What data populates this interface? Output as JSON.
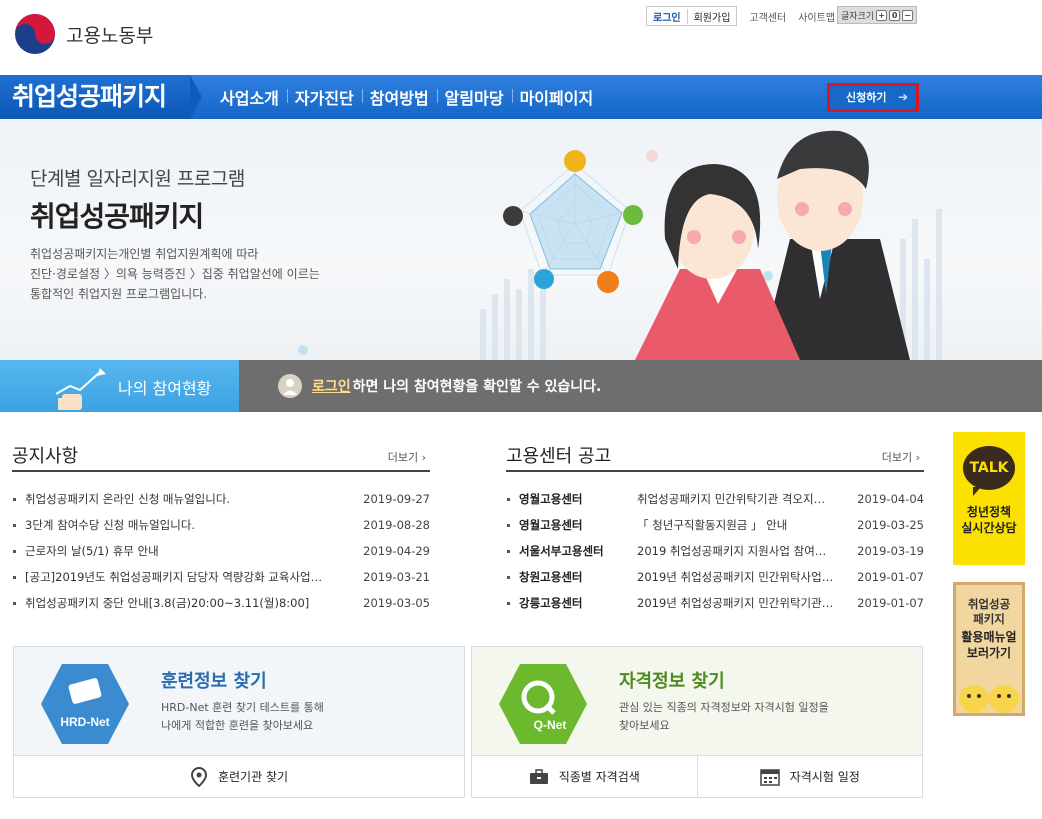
{
  "header": {
    "logo_text": "고용노동부",
    "util": {
      "login": "로그인",
      "signup": "회원가입",
      "customer_center": "고객센터",
      "sitemap": "사이트맵",
      "font_size": "글자크기",
      "font_plus": "+",
      "font_reset": "0",
      "font_minus": "−"
    }
  },
  "nav": {
    "brand": "취업성공패키지",
    "items": [
      "사업소개",
      "자가진단",
      "참여방법",
      "알림마당",
      "마이페이지"
    ],
    "apply": "신청하기"
  },
  "hero": {
    "subtitle": "단계별 일자리지원 프로그램",
    "title": "취업성공패키지",
    "desc1": "취업성공패키지는개인별 취업지원계획에 따라",
    "desc2": "진단·경로설정 〉의욕 능력증진 〉집중 취업알선에 이르는",
    "desc3": "통합적인 취업지원 프로그램입니다."
  },
  "participation": {
    "label": "나의 참여현황",
    "login_link": "로그인",
    "message": " 하면 나의 참여현황을 확인할 수 있습니다."
  },
  "notices": {
    "title": "공지사항",
    "more": "더보기",
    "items": [
      {
        "text": "취업성공패키지 온라인 신청 매뉴얼입니다.",
        "date": "2019-09-27"
      },
      {
        "text": "3단계 참여수당 신청 매뉴얼입니다.",
        "date": "2019-08-28"
      },
      {
        "text": "근로자의 날(5/1) 휴무 안내",
        "date": "2019-04-29"
      },
      {
        "text": "[공고]2019년도 취업성공패키지 담당자 역량강화 교육사업…",
        "date": "2019-03-21"
      },
      {
        "text": "취업성공패키지 중단 안내[3.8(금)20:00~3.11(월)8:00]",
        "date": "2019-03-05"
      }
    ]
  },
  "center_notices": {
    "title": "고용센터 공고",
    "more": "더보기",
    "items": [
      {
        "center": "영월고용센터",
        "text": "취업성공패키지 민간위탁기관 격오지…",
        "date": "2019-04-04"
      },
      {
        "center": "영월고용센터",
        "text": "「 청년구직활동지원금 」 안내",
        "date": "2019-03-25"
      },
      {
        "center": "서울서부고용센터",
        "text": "2019 취업성공패키지 지원사업 참여…",
        "date": "2019-03-19"
      },
      {
        "center": "창원고용센터",
        "text": "2019년 취업성공패키지 민간위탁사업…",
        "date": "2019-01-07"
      },
      {
        "center": "강릉고용센터",
        "text": "2019년 취업성공패키지 민간위탁기관…",
        "date": "2019-01-07"
      }
    ]
  },
  "side": {
    "kakao_badge": "TALK",
    "kakao_line1": "청년정책",
    "kakao_line2": "실시간상담",
    "manual_line1": "취업성공",
    "manual_line2": "패키지",
    "manual_line3": "활용매뉴얼",
    "manual_line4": "보러가기"
  },
  "cards": {
    "hrd": {
      "logo": "HRD-Net",
      "title": "훈련정보 찾기",
      "desc1": "HRD-Net 훈련 찾기 테스트를 통해",
      "desc2": "나에게 적합한 훈련을 찾아보세요",
      "link1": "훈련기관 찾기"
    },
    "qnet": {
      "logo": "Q-Net",
      "title": "자격정보 찾기",
      "desc1": "관심 있는 직종의 자격정보와 자격시험 일정을",
      "desc2": "찾아보세요",
      "link1": "직종별 자격검색",
      "link2": "자격시험 일정"
    }
  },
  "colors": {
    "nav_blue": "#1a6fd3",
    "highlight_red": "#e0141e",
    "participation_blue": "#45aae8",
    "kakao_yellow": "#fbe100"
  }
}
